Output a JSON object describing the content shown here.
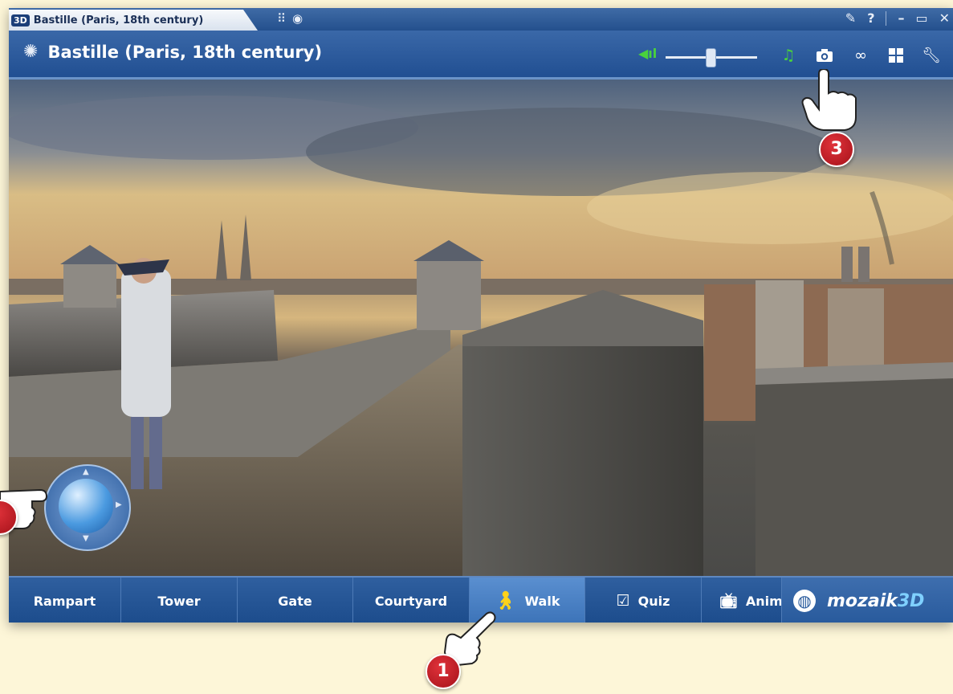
{
  "os_strip": {
    "tab_logo": "3D",
    "tab_title": "Bastille (Paris, 18th century)",
    "icons": [
      "grid-dots-icon",
      "globe-icon"
    ],
    "controls": [
      "pin-icon",
      "help-icon",
      "minimize-icon",
      "maximize-icon",
      "close-icon"
    ],
    "help_label": "?",
    "minimize_label": "–",
    "maximize_label": "▭",
    "close_label": "✕"
  },
  "header": {
    "title": "Bastille (Paris, 18th century)",
    "volume_level": 0.5,
    "icons": [
      "music-icon",
      "camera-icon",
      "link-icon",
      "layout-icon",
      "wrench-icon"
    ]
  },
  "navigation": {
    "items": [
      {
        "label": "Rampart"
      },
      {
        "label": "Tower"
      },
      {
        "label": "Gate"
      },
      {
        "label": "Courtyard"
      },
      {
        "label": "Walk",
        "icon": "walking-person-icon",
        "active": true
      },
      {
        "label": "Quiz",
        "icon": "checklist-icon"
      },
      {
        "label": "Anim",
        "icon": "tv-icon"
      }
    ]
  },
  "brand": {
    "name": "mozaik",
    "suffix": "3D"
  },
  "callouts": {
    "badge_1": "1",
    "badge_3": "3"
  },
  "colors": {
    "accent": "#2b5b9c",
    "volume_green": "#49d23c",
    "badge_red": "#c8202a"
  }
}
